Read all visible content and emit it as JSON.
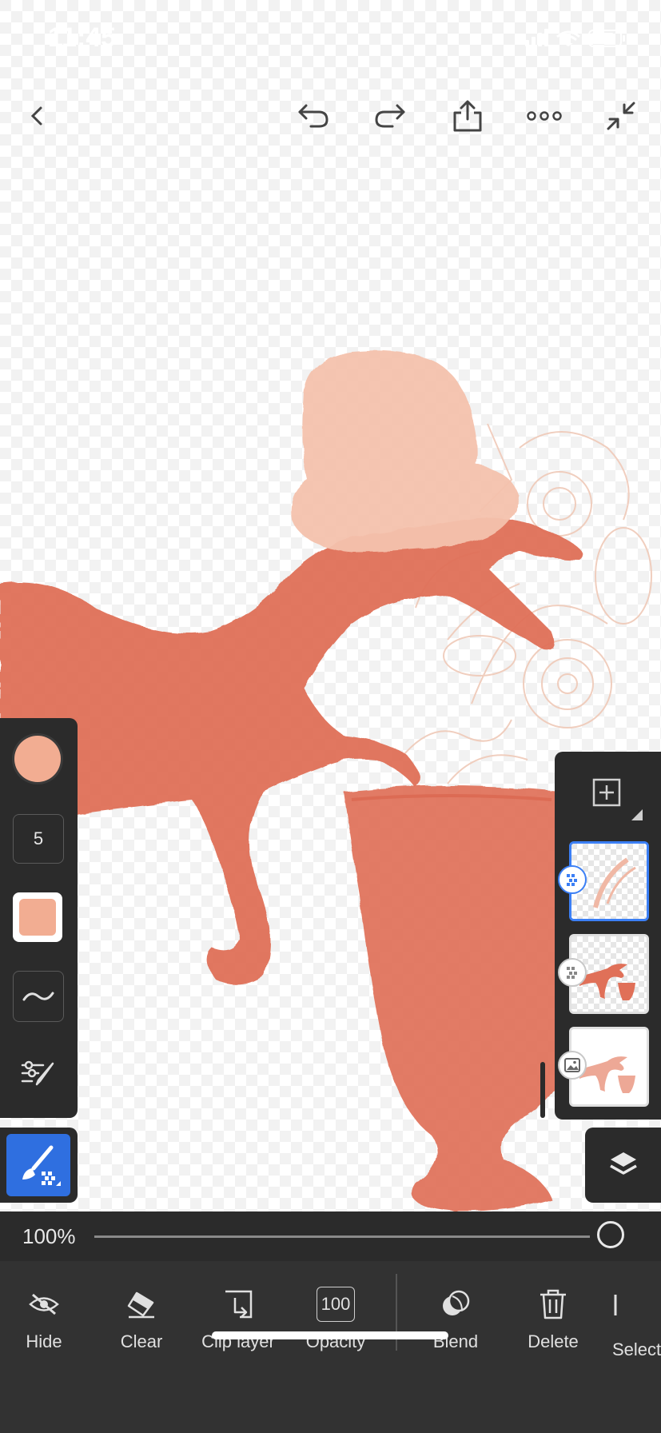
{
  "status_bar": {
    "time": "11:45"
  },
  "top_bar": {
    "back_icon": "chevron-left-icon",
    "undo_icon": "undo-icon",
    "redo_icon": "redo-icon",
    "share_icon": "share-icon",
    "more_icon": "more-icon",
    "fullscreen_icon": "collapse-icon"
  },
  "left_toolbar": {
    "brush_color": "#f2ad92",
    "brush_size": "5",
    "swatch_color": "#f2ad92"
  },
  "layers_panel": {
    "layer_count": 3,
    "selected_index": 0
  },
  "zoom": {
    "label": "100%",
    "value": 1.0
  },
  "actions": {
    "hide": "Hide",
    "clear": "Clear",
    "clip_layer": "Clip layer",
    "opacity_value": "100",
    "opacity": "Opacity",
    "blend": "Blend",
    "delete": "Delete",
    "select": "Select"
  },
  "colors": {
    "accent": "#2f6fe0",
    "panel": "#2b2b2b",
    "dino": "#e07058",
    "hat": "#f5c2ad",
    "lace": "#f0c8b8"
  }
}
